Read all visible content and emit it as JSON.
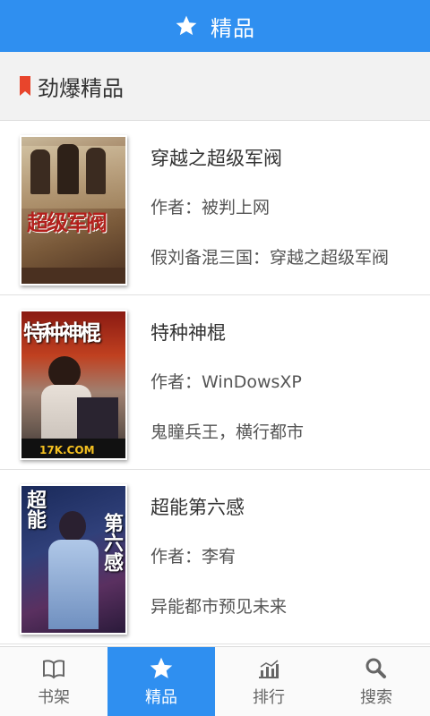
{
  "header": {
    "title": "精品",
    "icon": "star-icon"
  },
  "section": {
    "title": "劲爆精品",
    "accent": "#e8452c"
  },
  "colors": {
    "primary": "#2f8ff0"
  },
  "books": [
    {
      "title": "穿越之超级军阀",
      "author": "作者：被判上网",
      "desc": "假刘备混三国：穿越之超级军阀",
      "cover_text": "超级军阀"
    },
    {
      "title": "特种神棍",
      "author": "作者：WinDowsXP",
      "desc": "鬼瞳兵王，横行都市",
      "cover_text": "特种神棍",
      "cover_brand": "17K.COM"
    },
    {
      "title": "超能第六感",
      "author": "作者：李宥",
      "desc": "异能都市预见未来",
      "cover_text": "超能",
      "cover_text2": "第六感"
    }
  ],
  "nav": [
    {
      "label": "书架",
      "icon": "book-icon",
      "active": false
    },
    {
      "label": "精品",
      "icon": "star-icon",
      "active": true
    },
    {
      "label": "排行",
      "icon": "chart-icon",
      "active": false
    },
    {
      "label": "搜索",
      "icon": "search-icon",
      "active": false
    }
  ]
}
